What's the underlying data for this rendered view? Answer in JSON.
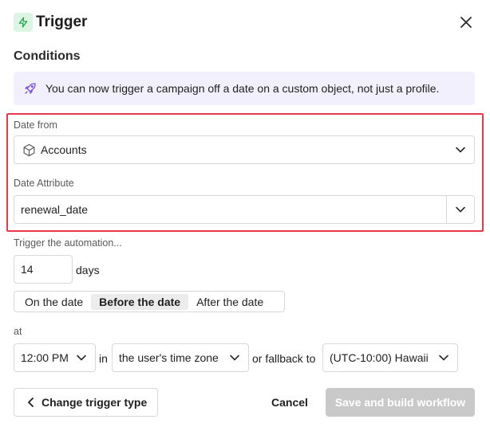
{
  "header": {
    "title": "Trigger",
    "icon": "lightning-bolt-icon",
    "icon_color": "#22a54a"
  },
  "conditions": {
    "title": "Conditions",
    "banner_text": "You can now trigger a campaign off a date on a custom object, not just a profile.",
    "banner_icon": "rocket-icon",
    "banner_icon_color": "#7b4fe6"
  },
  "date_from": {
    "label": "Date from",
    "value": "Accounts",
    "icon": "cube-icon"
  },
  "date_attribute": {
    "label": "Date Attribute",
    "value": "renewal_date"
  },
  "highlight_color": "#e8394a",
  "trigger": {
    "label": "Trigger the automation...",
    "offset_value": "14",
    "unit": "days",
    "options": [
      "On the date",
      "Before the date",
      "After the date"
    ],
    "selected": "Before the date"
  },
  "at": {
    "label": "at",
    "time": "12:00 PM",
    "in_text": "in",
    "timezone_mode": "the user's time zone",
    "fallback_text": "or fallback to",
    "fallback_timezone": "(UTC-10:00) Hawaii"
  },
  "footer": {
    "back_label": "Change trigger type",
    "cancel_label": "Cancel",
    "save_label": "Save and build workflow"
  }
}
